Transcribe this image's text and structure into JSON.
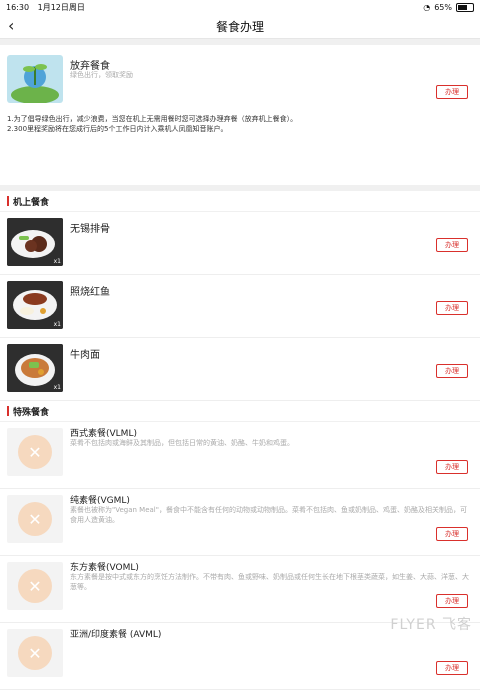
{
  "status": {
    "time": "16:30",
    "date": "1月12日周日",
    "battery_percent": "65%",
    "battery_level": 0.65
  },
  "nav": {
    "title": "餐食办理"
  },
  "abandon": {
    "name": "放弃餐食",
    "subtitle": "绿色出行，领取奖励",
    "button": "办理",
    "note_lines": [
      "1.为了倡导绿色出行，减少浪费，当您在机上无需用餐时您可选择办理弃餐（放弃机上餐食）。",
      "2.300里程奖励将在您成行后的5个工作日内计入乘机人凤凰知音账户。"
    ]
  },
  "sections": {
    "onboard": "机上餐食",
    "special": "特殊餐食"
  },
  "onboard_meals": [
    {
      "name": "无锡排骨",
      "qty": "x1",
      "button": "办理"
    },
    {
      "name": "照烧红鱼",
      "qty": "x1",
      "button": "办理"
    },
    {
      "name": "牛肉面",
      "qty": "x1",
      "button": "办理"
    }
  ],
  "special_meals": [
    {
      "name": "西式素餐(VLML)",
      "desc": "菜肴不包括肉或海鲜及其制品，但包括日常的黄油、奶酪、牛奶和鸡蛋。",
      "button": "办理"
    },
    {
      "name": "纯素餐(VGML)",
      "desc": "素餐也被称为\"Vegan Meal\"，餐食中不能含有任何的动物或动物制品。菜肴不包括肉、鱼或奶制品、鸡蛋、奶酪及相关制品，可食用人造黄油。",
      "button": "办理"
    },
    {
      "name": "东方素餐(VOML)",
      "desc": "东方素餐是按中式或东方的烹饪方法制作。不带有肉、鱼或野味、奶制品或任何生长在地下根茎类蔬菜，如生姜、大蒜、洋葱、大葱等。",
      "button": "办理"
    },
    {
      "name": "亚洲/印度素餐 (AVML)",
      "desc": "",
      "button": "办理"
    }
  ],
  "watermark": "FLYER 飞客"
}
